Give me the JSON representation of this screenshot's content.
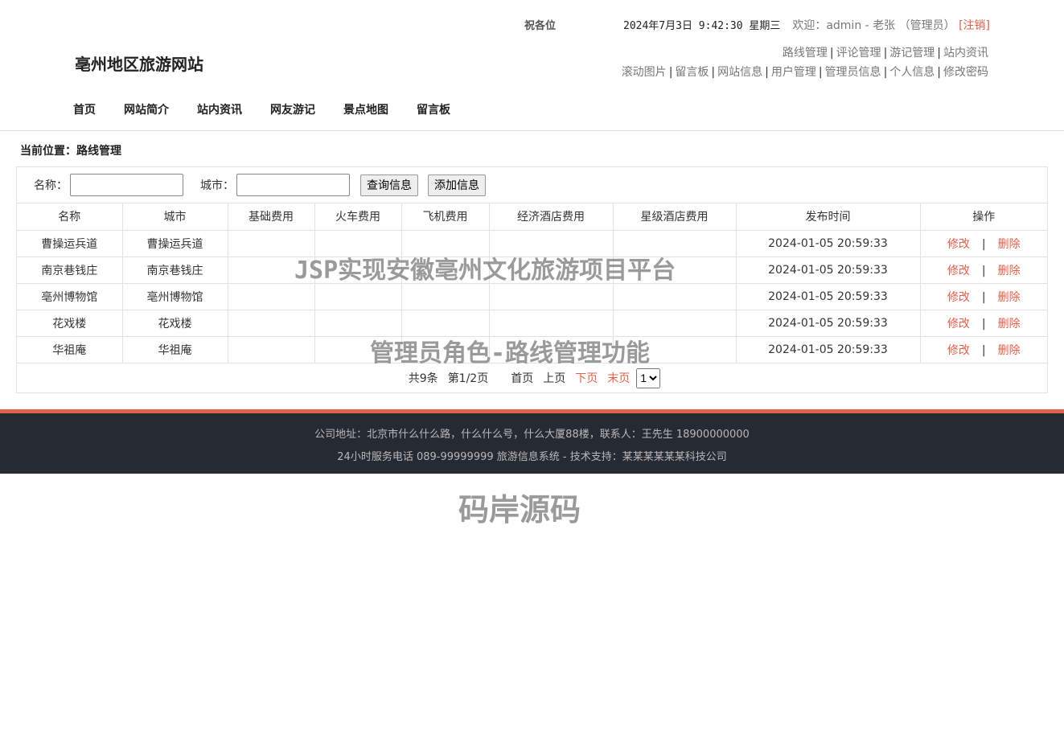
{
  "header": {
    "greeting": "祝各位",
    "datetime": "2024年7月3日 9:42:30 星期三",
    "welcome": "欢迎：admin - 老张 （管理员）",
    "logout": "[注销]",
    "site_title": "亳州地区旅游网站",
    "admin_links_row1": [
      "路线管理",
      "评论管理",
      "游记管理",
      "站内资讯"
    ],
    "admin_links_row2": [
      "滚动图片",
      "留言板",
      "网站信息",
      "用户管理",
      "管理员信息",
      "个人信息",
      "修改密码"
    ],
    "nav": [
      "首页",
      "网站简介",
      "站内资讯",
      "网友游记",
      "景点地图",
      "留言板"
    ]
  },
  "breadcrumb": "当前位置：路线管理",
  "search": {
    "name_label": "名称：",
    "city_label": "城市：",
    "name_value": "",
    "city_value": "",
    "query_button": "查询信息",
    "add_button": "添加信息"
  },
  "table": {
    "columns": [
      "名称",
      "城市",
      "基础费用",
      "火车费用",
      "飞机费用",
      "经济酒店费用",
      "星级酒店费用",
      "发布时间",
      "操作"
    ],
    "edit_label": "修改",
    "delete_label": "删除",
    "divider": "|",
    "rows": [
      [
        "曹操运兵道",
        "曹操运兵道",
        "",
        "",
        "",
        "",
        "",
        "2024-01-05 20:59:33"
      ],
      [
        "南京巷钱庄",
        "南京巷钱庄",
        "",
        "",
        "",
        "",
        "",
        "2024-01-05 20:59:33"
      ],
      [
        "亳州博物馆",
        "亳州博物馆",
        "",
        "",
        "",
        "",
        "",
        "2024-01-05 20:59:33"
      ],
      [
        "花戏楼",
        "花戏楼",
        "",
        "",
        "",
        "",
        "",
        "2024-01-05 20:59:33"
      ],
      [
        "华祖庵",
        "华祖庵",
        "",
        "",
        "",
        "",
        "",
        "2024-01-05 20:59:33"
      ]
    ]
  },
  "pager": {
    "total": "共9条",
    "page_info": "第1/2页",
    "first": "首页",
    "prev": "上页",
    "next": "下页",
    "last": "末页",
    "selected_page": "1"
  },
  "footer": {
    "line1": "公司地址：北京市什么什么路，什么什么号，什么大厦88楼，联系人：王先生 18900000000",
    "line2": "24小时服务电话   089-99999999   旅游信息系统 - 技术支持：某某某某某某科技公司"
  },
  "watermarks": {
    "w1": "JSP实现安徽亳州文化旅游项目平台",
    "w2": "管理员角色-路线管理功能",
    "w3": "码岸源码"
  },
  "colors": {
    "accent": "#e0604a",
    "footer_bg": "#262b33"
  }
}
